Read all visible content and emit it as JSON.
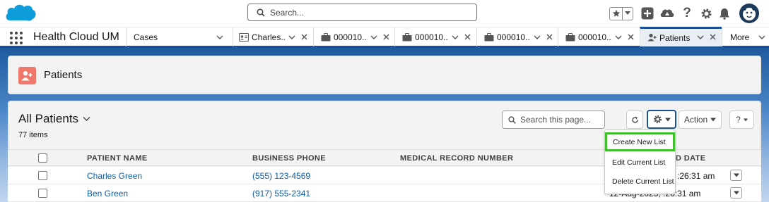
{
  "global_header": {
    "search_placeholder": "Search...",
    "icons": [
      "salesforce-cloud-logo",
      "favorites-star-icon",
      "favorites-dropdown-icon",
      "global-add-icon",
      "trailhead-icon",
      "help-icon",
      "setup-gear-icon",
      "notifications-bell-icon",
      "user-avatar"
    ]
  },
  "nav": {
    "app_name": "Health Cloud UM",
    "tabs": [
      {
        "label": "Cases",
        "icon": "",
        "closable": false
      },
      {
        "label": "Charles...",
        "icon": "contact-card-icon",
        "closable": true
      },
      {
        "label": "000010...",
        "icon": "briefcase-icon",
        "closable": true
      },
      {
        "label": "000010...",
        "icon": "briefcase-icon",
        "closable": true
      },
      {
        "label": "000010...",
        "icon": "briefcase-icon",
        "closable": true
      },
      {
        "label": "000010...",
        "icon": "briefcase-icon",
        "closable": true
      },
      {
        "label": "Patients",
        "icon": "patient-icon",
        "closable": true,
        "active": true
      }
    ],
    "more_label": "More"
  },
  "page_header": {
    "title": "Patients"
  },
  "list_view": {
    "title": "All Patients",
    "count": "77 items",
    "search_placeholder": "Search this page...",
    "action_label": "Action",
    "help_label": "?"
  },
  "table": {
    "headers": [
      "PATIENT NAME",
      "BUSINESS PHONE",
      "MEDICAL RECORD NUMBER",
      "D DATE"
    ],
    "rows": [
      {
        "name": "Charles Green",
        "phone": "(555) 123-4569",
        "mrn": "",
        "date": ":26:31 am"
      },
      {
        "name": "Ben Green",
        "phone": "(917) 555-2341",
        "mrn": "",
        "date": "12-Aug-2025, :26:31 am"
      }
    ]
  },
  "list_controls_menu": {
    "items": [
      "Create New List",
      "Edit Current List",
      "Delete Current List"
    ],
    "highlight_color": "#3ec12a"
  },
  "colors": {
    "brand_blue": "#1b5297",
    "link": "#0b5cab",
    "patient_icon_bg": "#f0786b"
  }
}
